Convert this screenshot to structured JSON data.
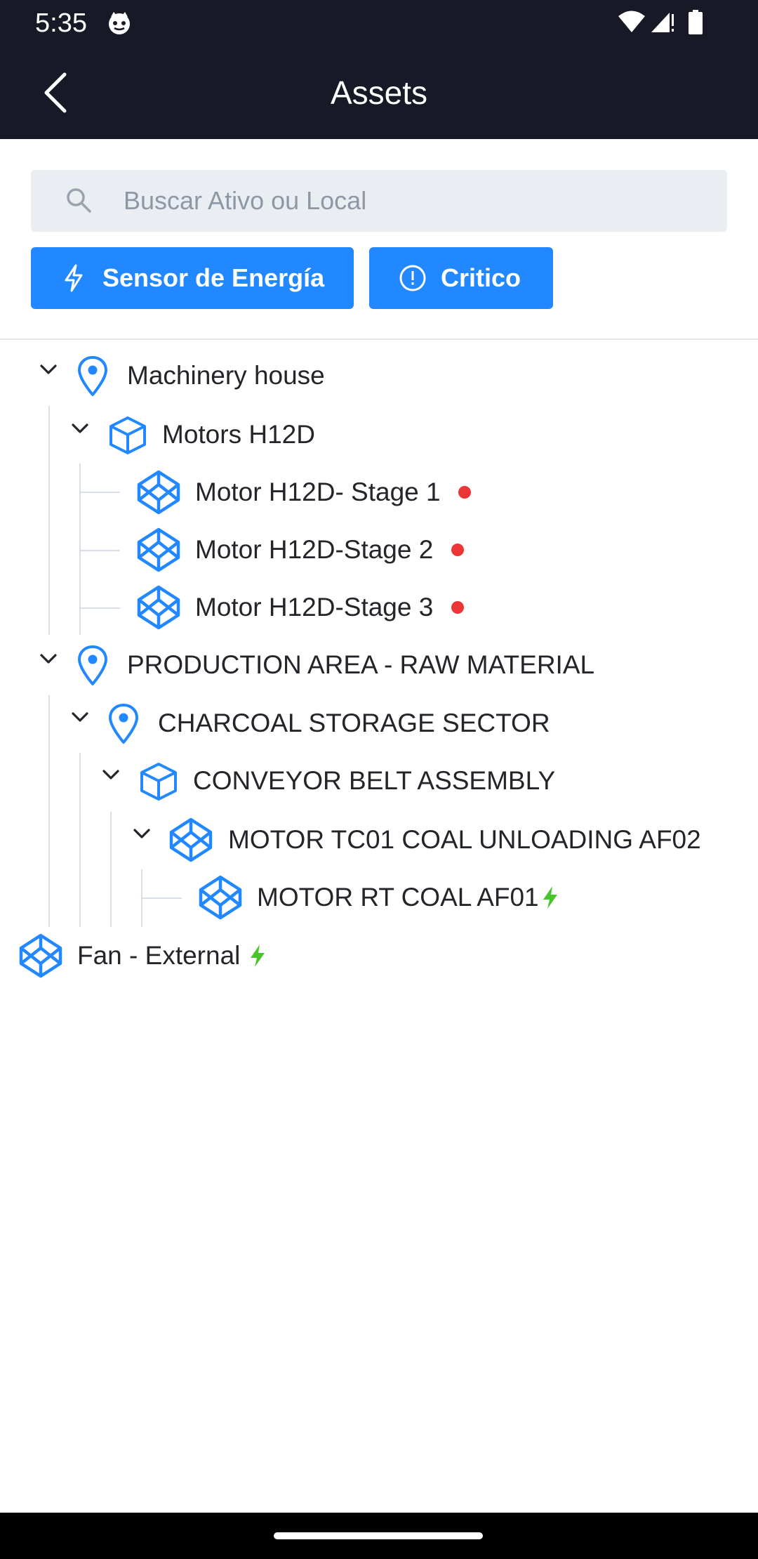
{
  "status_bar": {
    "time": "5:35"
  },
  "app_bar": {
    "title": "Assets"
  },
  "search": {
    "placeholder": "Buscar Ativo ou Local"
  },
  "filters": [
    {
      "label": "Sensor de Energía"
    },
    {
      "label": "Critico"
    }
  ],
  "colors": {
    "header_bg": "#171a26",
    "accent": "#2188ff",
    "critical": "#ec3535",
    "energy": "#47c52b"
  },
  "tree": [
    {
      "label": "Machinery house",
      "type": "location",
      "expanded": true
    },
    {
      "label": "Motors H12D",
      "type": "asset",
      "expanded": true
    },
    {
      "label": "Motor H12D- Stage 1",
      "type": "component",
      "status": "critical"
    },
    {
      "label": "Motor H12D-Stage 2",
      "type": "component",
      "status": "critical"
    },
    {
      "label": "Motor H12D-Stage 3",
      "type": "component",
      "status": "critical"
    },
    {
      "label": "PRODUCTION AREA - RAW MATERIAL",
      "type": "location",
      "expanded": true
    },
    {
      "label": "CHARCOAL STORAGE SECTOR",
      "type": "location",
      "expanded": true
    },
    {
      "label": "CONVEYOR BELT ASSEMBLY",
      "type": "asset",
      "expanded": true
    },
    {
      "label": "MOTOR TC01 COAL UNLOADING AF02",
      "type": "component",
      "expanded": true
    },
    {
      "label": "MOTOR RT COAL AF01",
      "type": "component",
      "status": "energy"
    },
    {
      "label": "Fan - External",
      "type": "component",
      "status": "energy"
    }
  ]
}
